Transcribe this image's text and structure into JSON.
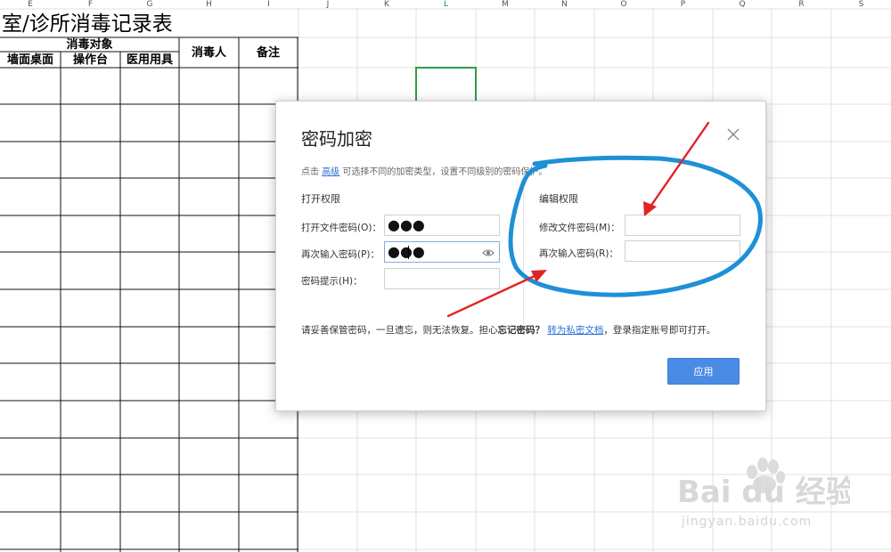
{
  "sheet": {
    "columns": [
      "E",
      "F",
      "G",
      "H",
      "I",
      "J",
      "K",
      "L",
      "M",
      "N",
      "O",
      "P",
      "Q",
      "R",
      "S"
    ],
    "active_column": "L",
    "title": "室/诊所消毒记录表",
    "table_headers": {
      "group": "消毒对象",
      "sub": [
        "墙面桌面",
        "操作台",
        "医用用具"
      ],
      "person": "消毒人",
      "remark": "备注"
    }
  },
  "dialog": {
    "title": "密码加密",
    "hint_prefix": "点击",
    "hint_link": "高级",
    "hint_suffix": "可选择不同的加密类型，设置不同级别的密码保护。",
    "open_section": "打开权限",
    "edit_section": "编辑权限",
    "open_password_label": "打开文件密码(O)：",
    "open_password_value": "●●●",
    "confirm_open_label": "再次输入密码(P)：",
    "confirm_open_value": "●●●",
    "hint_label": "密码提示(H)：",
    "hint_value": "",
    "modify_password_label": "修改文件密码(M)：",
    "modify_password_value": "",
    "confirm_modify_label": "再次输入密码(R)：",
    "confirm_modify_value": "",
    "warning_prefix": "请妥善保管密码，一旦遗忘，则无法恢复。担心",
    "warning_bold": "忘记密码？",
    "warning_link": "转为私密文档",
    "warning_suffix": "，登录指定账号即可打开。",
    "apply_label": "应用"
  },
  "watermark": {
    "brand": "Bai du 经验",
    "url": "jingyan.baidu.com"
  },
  "colors": {
    "annotation_red": "#e02424",
    "annotation_blue": "#1e90d6",
    "apply_button": "#4a8be6",
    "link": "#2b6fd6"
  },
  "icons": [
    "close-icon",
    "eye-icon",
    "baidu-paw-icon"
  ]
}
